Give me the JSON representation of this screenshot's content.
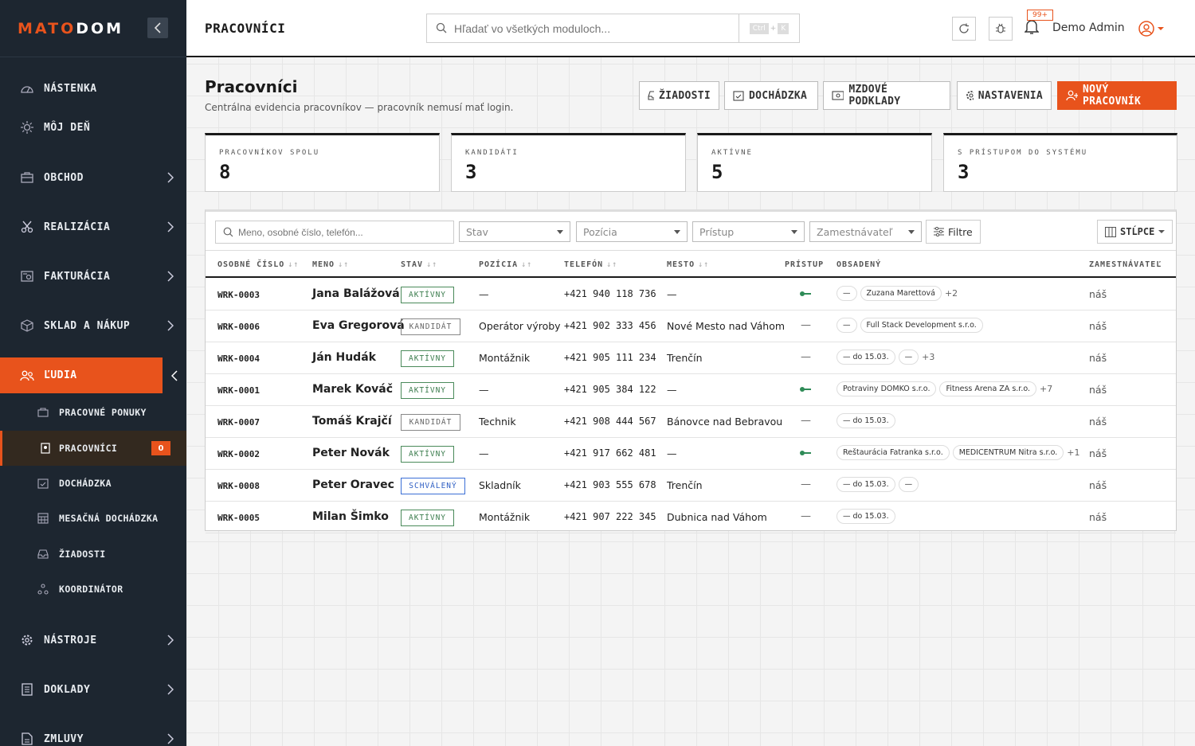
{
  "app": {
    "logo_a": "MATO",
    "logo_b": "DOM"
  },
  "sidebar": {
    "items": [
      {
        "label": "NÁSTENKA"
      },
      {
        "label": "MÔJ DEŇ"
      },
      {
        "label": "OBCHOD"
      },
      {
        "label": "REALIZÁCIA"
      },
      {
        "label": "FAKTURÁCIA"
      },
      {
        "label": "SKLAD A NÁKUP"
      },
      {
        "label": "ĽUDIA"
      },
      {
        "label": "NÁSTROJE"
      },
      {
        "label": "DOKLADY"
      },
      {
        "label": "ZMLUVY"
      }
    ],
    "sub": [
      {
        "label": "PRACOVNÉ PONUKY"
      },
      {
        "label": "PRACOVNÍCI",
        "badge": "0"
      },
      {
        "label": "DOCHÁDZKA"
      },
      {
        "label": "MESAČNÁ DOCHÁDZKA"
      },
      {
        "label": "ŽIADOSTI"
      },
      {
        "label": "KOORDINÁTOR"
      }
    ]
  },
  "topbar": {
    "title": "PRACOVNÍCI",
    "search_placeholder": "Hľadať vo všetkých moduloch...",
    "kbd_a": "Ctrl",
    "kbd_plus": "+",
    "kbd_b": "K",
    "notif_count": "99+",
    "user_name": "Demo Admin"
  },
  "page": {
    "title": "Pracovníci",
    "subtitle": "Centrálna evidencia pracovníkov — pracovník nemusí mať login.",
    "actions": {
      "requests": "ŽIADOSTI",
      "attendance": "DOCHÁDZKA",
      "payroll": "MZDOVÉ PODKLADY",
      "settings": "NASTAVENIA",
      "new": "NOVÝ PRACOVNÍK"
    }
  },
  "stats": [
    {
      "label": "PRACOVNÍKOV SPOLU",
      "value": "8"
    },
    {
      "label": "KANDIDÁTI",
      "value": "3"
    },
    {
      "label": "AKTÍVNE",
      "value": "5"
    },
    {
      "label": "S PRÍSTUPOM DO SYSTÉMU",
      "value": "3"
    }
  ],
  "filters": {
    "search_placeholder": "Meno, osobné číslo, telefón...",
    "status": "Stav",
    "position": "Pozícia",
    "access": "Prístup",
    "employer": "Zamestnávateľ",
    "filters_btn": "Filtre",
    "columns_btn": "STĹPCE"
  },
  "table": {
    "headers": {
      "id": "OSOBNÉ ČÍSLO",
      "name": "MENO",
      "status": "STAV",
      "position": "POZÍCIA",
      "phone": "TELEFÓN",
      "city": "MESTO",
      "access": "PRÍSTUP",
      "occupied": "OBSADENÝ",
      "employer": "ZAMESTNÁVATEĽ"
    },
    "rows": [
      {
        "id": "WRK-0003",
        "name": "Jana Balážová",
        "status": "AKTÍVNY",
        "stype": "act",
        "position": "—",
        "phone": "+421 940 118 736",
        "city": "—",
        "access": true,
        "chips": [
          "—",
          "Zuzana Marettová"
        ],
        "more": "+2",
        "employer": "náš"
      },
      {
        "id": "WRK-0006",
        "name": "Eva Gregorová",
        "status": "KANDIDÁT",
        "stype": "kand",
        "position": "Operátor výroby",
        "phone": "+421 902 333 456",
        "city": "Nové Mesto nad Váhom",
        "access": false,
        "chips": [
          "—",
          "Full Stack Development s.r.o."
        ],
        "more": "",
        "employer": "náš"
      },
      {
        "id": "WRK-0004",
        "name": "Ján Hudák",
        "status": "AKTÍVNY",
        "stype": "act",
        "position": "Montážnik",
        "phone": "+421 905 111 234",
        "city": "Trenčín",
        "access": false,
        "chips": [
          "— do 15.03.",
          "—"
        ],
        "more": "+3",
        "employer": "náš"
      },
      {
        "id": "WRK-0001",
        "name": "Marek Kováč",
        "status": "AKTÍVNY",
        "stype": "act",
        "position": "—",
        "phone": "+421 905 384 122",
        "city": "—",
        "access": true,
        "chips": [
          "Potraviny DOMKO s.r.o.",
          "Fitness Arena ZA s.r.o."
        ],
        "more": "+7",
        "employer": "náš"
      },
      {
        "id": "WRK-0007",
        "name": "Tomáš Krajčí",
        "status": "KANDIDÁT",
        "stype": "kand",
        "position": "Technik",
        "phone": "+421 908 444 567",
        "city": "Bánovce nad Bebravou",
        "access": false,
        "chips": [
          "— do 15.03."
        ],
        "more": "",
        "employer": "náš"
      },
      {
        "id": "WRK-0002",
        "name": "Peter Novák",
        "status": "AKTÍVNY",
        "stype": "act",
        "position": "—",
        "phone": "+421 917 662 481",
        "city": "—",
        "access": true,
        "chips": [
          "Reštaurácia Fatranka s.r.o.",
          "MEDICENTRUM Nitra s.r.o."
        ],
        "more": "+1",
        "employer": "náš"
      },
      {
        "id": "WRK-0008",
        "name": "Peter Oravec",
        "status": "SCHVÁLENÝ",
        "stype": "schv",
        "position": "Skladník",
        "phone": "+421 903 555 678",
        "city": "Trenčín",
        "access": false,
        "chips": [
          "— do 15.03.",
          "—"
        ],
        "more": "",
        "employer": "náš"
      },
      {
        "id": "WRK-0005",
        "name": "Milan Šimko",
        "status": "AKTÍVNY",
        "stype": "act",
        "position": "Montážnik",
        "phone": "+421 907 222 345",
        "city": "Dubnica nad Váhom",
        "access": false,
        "chips": [
          "— do 15.03."
        ],
        "more": "",
        "employer": "náš"
      }
    ]
  },
  "colors": {
    "accent": "#e8531c",
    "sidebar": "#1d2630",
    "active_status": "#3c7d4e",
    "approved_status": "#2f5fc4"
  }
}
